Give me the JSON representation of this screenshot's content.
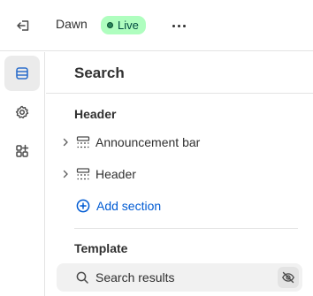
{
  "topbar": {
    "exit_icon": "exit-icon",
    "theme_name": "Dawn",
    "status_badge": "Live",
    "status_color": "#affebf",
    "more_icon": "ellipsis-icon"
  },
  "rail": {
    "items": [
      {
        "icon": "sections-icon",
        "active": true
      },
      {
        "icon": "gear-icon",
        "active": false
      },
      {
        "icon": "apps-icon",
        "active": false
      }
    ]
  },
  "panel": {
    "title": "Search",
    "header_group": {
      "heading": "Header",
      "sections": [
        {
          "label": "Announcement bar",
          "icon": "section-icon"
        },
        {
          "label": "Header",
          "icon": "section-icon"
        }
      ],
      "add_label": "Add section"
    },
    "template_group": {
      "heading": "Template",
      "sections": [
        {
          "label": "Search results",
          "icon": "search-icon",
          "hidden_icon": "eye-slash-icon"
        }
      ]
    }
  },
  "colors": {
    "accent": "#005bd3",
    "text": "#303030",
    "border": "#e3e3e3"
  }
}
